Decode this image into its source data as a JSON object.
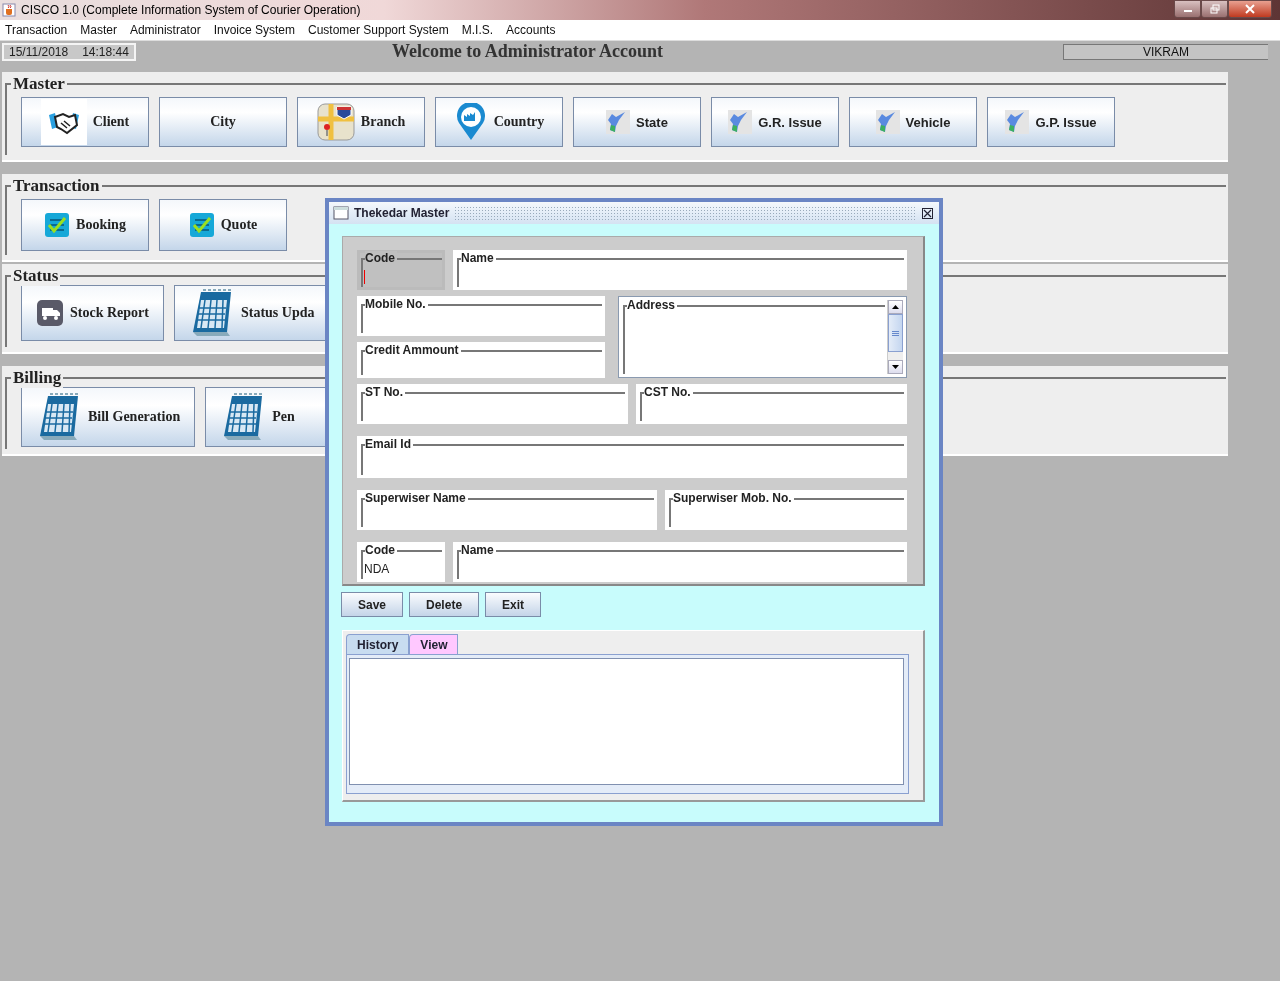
{
  "window": {
    "title": "CISCO 1.0 (Complete Information System of Courier Operation)"
  },
  "menu": [
    {
      "label": "Transaction"
    },
    {
      "label": "Master"
    },
    {
      "label": "Administrator"
    },
    {
      "label": "Invoice System"
    },
    {
      "label": "Customer Support System"
    },
    {
      "label": "M.I.S."
    },
    {
      "label": "Accounts"
    }
  ],
  "status_bar": {
    "date": "15/11/2018",
    "time": "14:18:44",
    "welcome": "Welcome to Administrator Account",
    "user": "VIKRAM"
  },
  "sections": [
    {
      "title": "Master",
      "buttons": [
        {
          "label": "Client",
          "kind": "handshake"
        },
        {
          "label": "City",
          "kind": "none"
        },
        {
          "label": "Branch",
          "kind": "map"
        },
        {
          "label": "Country",
          "kind": "pin"
        },
        {
          "label": "State",
          "kind": "map-shape"
        },
        {
          "label": "G.R. Issue",
          "kind": "map-shape"
        },
        {
          "label": "Vehicle",
          "kind": "map-shape"
        },
        {
          "label": "G.P. Issue",
          "kind": "map-shape"
        }
      ]
    },
    {
      "title": "Transaction",
      "buttons": [
        {
          "label": "Booking",
          "kind": "checklist"
        },
        {
          "label": "Quote",
          "kind": "checklist"
        }
      ]
    },
    {
      "title": "Status",
      "buttons": [
        {
          "label": "Stock Report",
          "kind": "truck"
        },
        {
          "label": "Status Upda",
          "kind": "calendar"
        }
      ]
    },
    {
      "title": "Billing",
      "buttons": [
        {
          "label": "Bill Generation",
          "kind": "calendar"
        },
        {
          "label": "Pen",
          "kind": "calendar"
        }
      ]
    }
  ],
  "dialog": {
    "title": "Thekedar Master",
    "rows": [
      {
        "kind": "narrow-wide",
        "fields": [
          {
            "label": "Code",
            "disabled": true,
            "focused": true
          },
          {
            "label": "Name",
            "disabled": false,
            "focused": false
          }
        ]
      },
      {
        "kind": "stack-area",
        "fields": [
          {
            "label": "Mobile No.",
            "disabled": false,
            "focused": false
          },
          {
            "label": "Credit Ammount",
            "disabled": false,
            "focused": false
          },
          {
            "label": "Address",
            "disabled": false,
            "focused": false
          }
        ]
      },
      {
        "kind": "pair",
        "fields": [
          {
            "label": "ST No.",
            "disabled": false,
            "focused": false
          },
          {
            "label": "CST No.",
            "disabled": false,
            "focused": false
          }
        ]
      },
      {
        "kind": "full",
        "fields": [
          {
            "label": "Email Id",
            "disabled": false,
            "focused": false
          }
        ]
      },
      {
        "kind": "wide-narrow",
        "fields": [
          {
            "label": "Superwiser Name",
            "disabled": false,
            "focused": false
          },
          {
            "label": "Superwiser Mob. No.",
            "disabled": false,
            "focused": false
          }
        ]
      },
      {
        "kind": "narrow-wide",
        "fields": [
          {
            "label": "Code",
            "value": "NDA",
            "disabled": false,
            "focused": false
          },
          {
            "label": "Name",
            "disabled": false,
            "focused": false
          }
        ]
      }
    ],
    "buttons": [
      {
        "label": "Save"
      },
      {
        "label": "Delete"
      },
      {
        "label": "Exit"
      }
    ],
    "tabs": [
      {
        "label": "History",
        "selected": true
      },
      {
        "label": "View",
        "selected": false
      }
    ]
  }
}
